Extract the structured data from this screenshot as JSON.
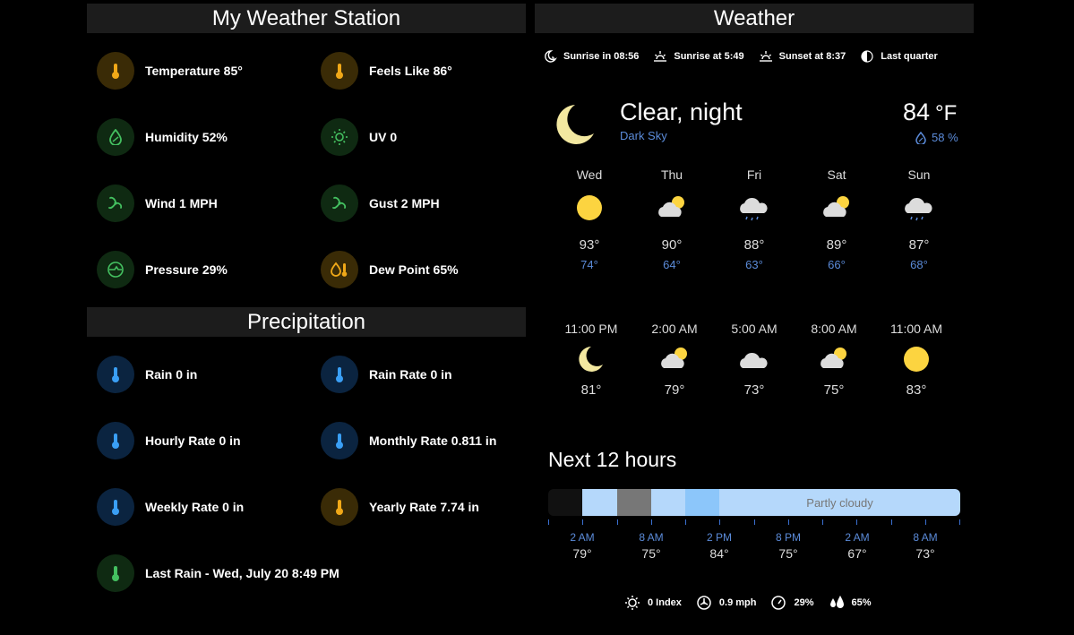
{
  "station": {
    "title": "My Weather Station",
    "items": [
      {
        "label": "Temperature 85°",
        "icon": "thermometer-icon",
        "tone": "amber"
      },
      {
        "label": "Feels Like 86°",
        "icon": "thermometer-icon",
        "tone": "amber"
      },
      {
        "label": "Humidity 52%",
        "icon": "water-percent-icon",
        "tone": "green"
      },
      {
        "label": "UV 0",
        "icon": "sun-icon",
        "tone": "green"
      },
      {
        "label": "Wind 1 MPH",
        "icon": "wind-icon",
        "tone": "green"
      },
      {
        "label": "Gust 2 MPH",
        "icon": "wind-icon",
        "tone": "green"
      },
      {
        "label": "Pressure 29%",
        "icon": "gauge-icon",
        "tone": "green"
      },
      {
        "label": "Dew Point 65%",
        "icon": "dew-point-icon",
        "tone": "amber"
      }
    ]
  },
  "precip": {
    "title": "Precipitation",
    "items": [
      {
        "label": "Rain 0 in",
        "tone": "blue"
      },
      {
        "label": "Rain Rate 0 in",
        "tone": "blue"
      },
      {
        "label": "Hourly Rate 0 in",
        "tone": "blue"
      },
      {
        "label": "Monthly Rate 0.811 in",
        "tone": "blue"
      },
      {
        "label": "Weekly Rate 0 in",
        "tone": "blue"
      },
      {
        "label": "Yearly Rate 7.74 in",
        "tone": "amber"
      },
      {
        "label": "Last Rain - Wed, July 20 8:49 PM",
        "tone": "green"
      }
    ]
  },
  "weather": {
    "title": "Weather",
    "sun": [
      {
        "label": "Sunrise in 08:56",
        "icon": "moon-clock-icon"
      },
      {
        "label": "Sunrise at 5:49",
        "icon": "sunrise-icon"
      },
      {
        "label": "Sunset at 8:37",
        "icon": "sunset-icon"
      },
      {
        "label": "Last quarter",
        "icon": "moon-last-quarter-icon"
      }
    ],
    "condition": "Clear, night",
    "provider": "Dark Sky",
    "temp": "84",
    "unit": "°F",
    "humidity": "58 %",
    "daily": [
      {
        "day": "Wed",
        "icon": "sunny",
        "hi": "93°",
        "lo": "74°"
      },
      {
        "day": "Thu",
        "icon": "partly-cloudy",
        "hi": "90°",
        "lo": "64°"
      },
      {
        "day": "Fri",
        "icon": "rainy",
        "hi": "88°",
        "lo": "63°"
      },
      {
        "day": "Sat",
        "icon": "partly-cloudy",
        "hi": "89°",
        "lo": "66°"
      },
      {
        "day": "Sun",
        "icon": "rainy",
        "hi": "87°",
        "lo": "68°"
      }
    ],
    "hourly": [
      {
        "time": "11:00 PM",
        "icon": "night",
        "temp": "81°"
      },
      {
        "time": "2:00 AM",
        "icon": "partly-cloudy",
        "temp": "79°"
      },
      {
        "time": "5:00 AM",
        "icon": "cloudy",
        "temp": "73°"
      },
      {
        "time": "8:00 AM",
        "icon": "partly-cloudy",
        "temp": "75°"
      },
      {
        "time": "11:00 AM",
        "icon": "sunny",
        "temp": "83°"
      }
    ]
  },
  "next12": {
    "title": "Next 12 hours",
    "bar_label": "Partly cloudy",
    "times": [
      {
        "time": "2 AM",
        "temp": "79°"
      },
      {
        "time": "8 AM",
        "temp": "75°"
      },
      {
        "time": "2 PM",
        "temp": "84°"
      },
      {
        "time": "8 PM",
        "temp": "75°"
      },
      {
        "time": "2 AM",
        "temp": "67°"
      },
      {
        "time": "8 AM",
        "temp": "73°"
      }
    ]
  },
  "bottom": [
    {
      "label": "0 Index",
      "icon": "sun-outline-icon"
    },
    {
      "label": "0.9 mph",
      "icon": "fan-icon"
    },
    {
      "label": "29%",
      "icon": "gauge-icon"
    },
    {
      "label": "65%",
      "icon": "dew-drops-icon"
    }
  ]
}
